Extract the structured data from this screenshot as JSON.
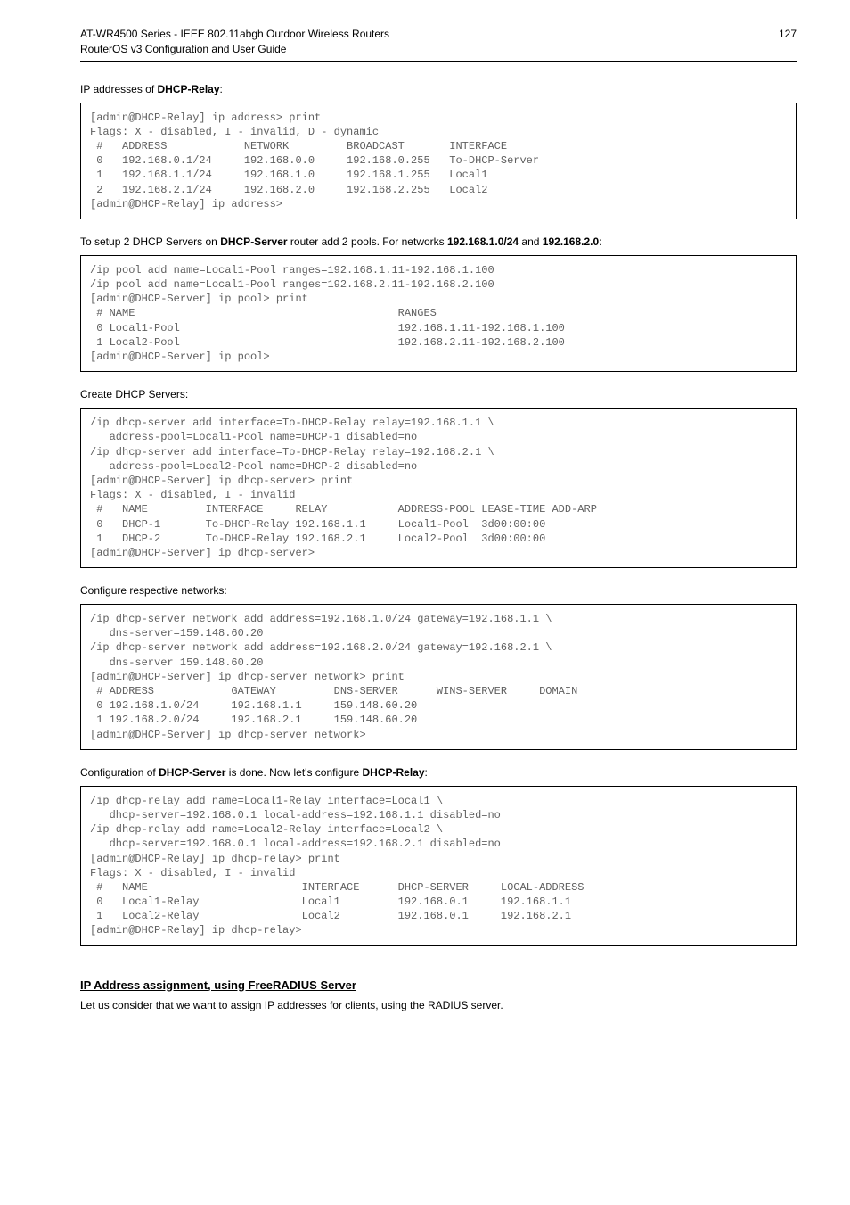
{
  "header": {
    "line1": "AT-WR4500 Series - IEEE 802.11abgh Outdoor Wireless Routers",
    "line2": "RouterOS v3 Configuration and User Guide",
    "page_number": "127"
  },
  "sections": {
    "s1_title_pre": "IP addresses of ",
    "s1_title_bold": "DHCP-Relay",
    "s1_title_post": ":",
    "s1_code": "[admin@DHCP-Relay] ip address> print\nFlags: X - disabled, I - invalid, D - dynamic\n #   ADDRESS            NETWORK         BROADCAST       INTERFACE\n 0   192.168.0.1/24     192.168.0.0     192.168.0.255   To-DHCP-Server\n 1   192.168.1.1/24     192.168.1.0     192.168.1.255   Local1\n 2   192.168.2.1/24     192.168.2.0     192.168.2.255   Local2\n[admin@DHCP-Relay] ip address>",
    "s2_title_pre": "To setup 2 DHCP Servers on ",
    "s2_title_bold1": "DHCP-Server",
    "s2_title_mid": " router add 2 pools. For networks ",
    "s2_title_bold2": "192.168.1.0/24",
    "s2_title_mid2": " and ",
    "s2_title_bold3": "192.168.2.0",
    "s2_title_post": ":",
    "s2_code": "/ip pool add name=Local1-Pool ranges=192.168.1.11-192.168.1.100\n/ip pool add name=Local1-Pool ranges=192.168.2.11-192.168.2.100\n[admin@DHCP-Server] ip pool> print\n # NAME                                         RANGES\n 0 Local1-Pool                                  192.168.1.11-192.168.1.100\n 1 Local2-Pool                                  192.168.2.11-192.168.2.100\n[admin@DHCP-Server] ip pool>",
    "s3_title": "Create DHCP Servers:",
    "s3_code": "/ip dhcp-server add interface=To-DHCP-Relay relay=192.168.1.1 \\\n   address-pool=Local1-Pool name=DHCP-1 disabled=no\n/ip dhcp-server add interface=To-DHCP-Relay relay=192.168.2.1 \\\n   address-pool=Local2-Pool name=DHCP-2 disabled=no\n[admin@DHCP-Server] ip dhcp-server> print\nFlags: X - disabled, I - invalid\n #   NAME         INTERFACE     RELAY           ADDRESS-POOL LEASE-TIME ADD-ARP\n 0   DHCP-1       To-DHCP-Relay 192.168.1.1     Local1-Pool  3d00:00:00\n 1   DHCP-2       To-DHCP-Relay 192.168.2.1     Local2-Pool  3d00:00:00\n[admin@DHCP-Server] ip dhcp-server>",
    "s4_title": "Configure respective networks:",
    "s4_code": "/ip dhcp-server network add address=192.168.1.0/24 gateway=192.168.1.1 \\\n   dns-server=159.148.60.20\n/ip dhcp-server network add address=192.168.2.0/24 gateway=192.168.2.1 \\\n   dns-server 159.148.60.20\n[admin@DHCP-Server] ip dhcp-server network> print\n # ADDRESS            GATEWAY         DNS-SERVER      WINS-SERVER     DOMAIN\n 0 192.168.1.0/24     192.168.1.1     159.148.60.20\n 1 192.168.2.0/24     192.168.2.1     159.148.60.20\n[admin@DHCP-Server] ip dhcp-server network>",
    "s5_title_pre": "Configuration of ",
    "s5_title_bold1": "DHCP-Server",
    "s5_title_mid": " is done. Now let's configure ",
    "s5_title_bold2": "DHCP-Relay",
    "s5_title_post": ":",
    "s5_code": "/ip dhcp-relay add name=Local1-Relay interface=Local1 \\\n   dhcp-server=192.168.0.1 local-address=192.168.1.1 disabled=no\n/ip dhcp-relay add name=Local2-Relay interface=Local2 \\\n   dhcp-server=192.168.0.1 local-address=192.168.2.1 disabled=no\n[admin@DHCP-Relay] ip dhcp-relay> print\nFlags: X - disabled, I - invalid\n #   NAME                        INTERFACE      DHCP-SERVER     LOCAL-ADDRESS\n 0   Local1-Relay                Local1         192.168.0.1     192.168.1.1\n 1   Local2-Relay                Local2         192.168.0.1     192.168.2.1\n[admin@DHCP-Relay] ip dhcp-relay>",
    "s6_heading": "IP Address assignment, using FreeRADIUS Server",
    "s6_para": "Let us consider that we want to assign IP addresses for clients, using the RADIUS server."
  }
}
